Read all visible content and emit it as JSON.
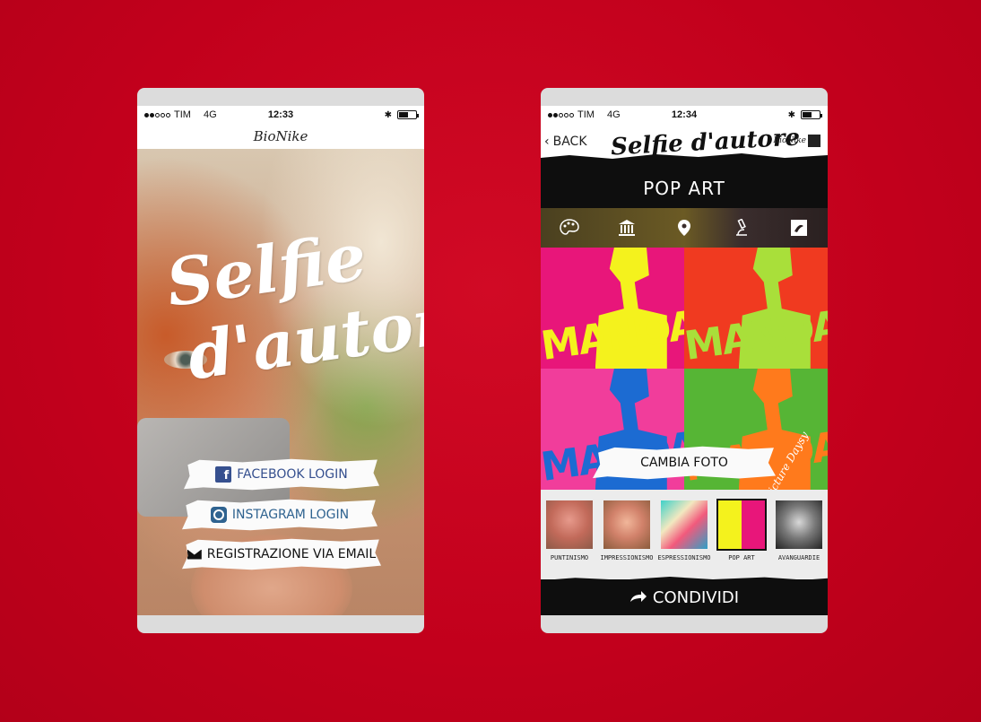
{
  "left_phone": {
    "status": {
      "carrier": "TIM",
      "network": "4G",
      "time": "12:33"
    },
    "brand": "BioNike",
    "hero_title_line1": "Selfie",
    "hero_title_line2": "d'autore",
    "buttons": {
      "facebook": "FACEBOOK LOGIN",
      "instagram": "INSTAGRAM LOGIN",
      "email": "REGISTRAZIONE VIA EMAIL"
    }
  },
  "right_phone": {
    "status": {
      "carrier": "TIM",
      "network": "4G",
      "time": "12:34"
    },
    "back_label": "BACK",
    "app_title": "Selfie d'autore",
    "brand": "BioNike",
    "section_title": "POP ART",
    "icons": [
      "palette-icon",
      "museum-icon",
      "location-pin-icon",
      "microscope-icon",
      "brand-logo-icon"
    ],
    "tiles_word": "MANOA",
    "signature": "Picture Daysy",
    "cambia_label": "CAMBIA FOTO",
    "filters": [
      {
        "label": "PUNTINISMO",
        "selected": false
      },
      {
        "label": "IMPRESSIONISMO",
        "selected": false
      },
      {
        "label": "ESPRESSIONISMO",
        "selected": false
      },
      {
        "label": "POP ART",
        "selected": true
      },
      {
        "label": "AVANGUARDIE",
        "selected": false
      }
    ],
    "share_label": "CONDIVIDI"
  }
}
